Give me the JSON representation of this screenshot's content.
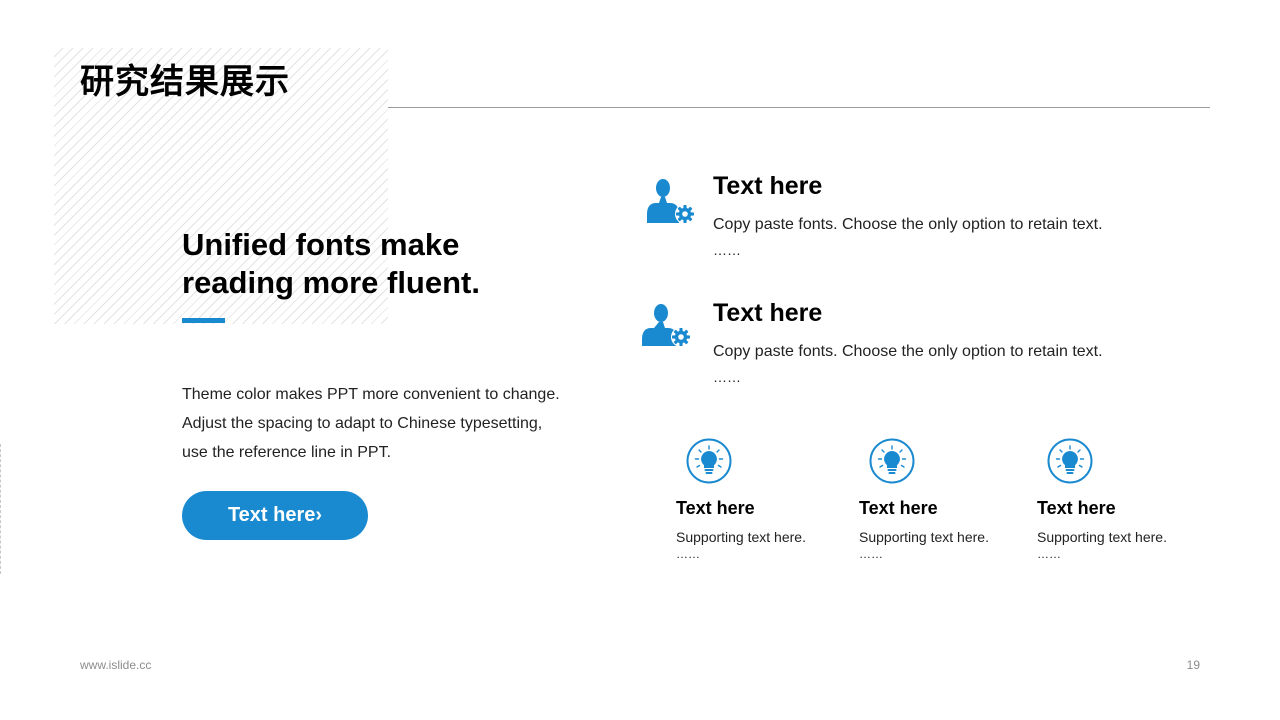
{
  "title": "研究结果展示",
  "headline": [
    "Unified fonts make",
    "reading more fluent."
  ],
  "body": [
    "Theme color makes PPT more convenient to change.",
    "Adjust the spacing to adapt to Chinese typesetting,",
    "use the reference line in PPT."
  ],
  "cta_label": "Text here›",
  "features": [
    {
      "heading": "Text here",
      "desc": "Copy paste fonts. Choose the only option to retain text.",
      "ellipsis": "……",
      "icon": "user-gear-icon"
    },
    {
      "heading": "Text here",
      "desc": "Copy paste fonts. Choose the only option to retain text.",
      "ellipsis": "……",
      "icon": "user-gear-icon"
    }
  ],
  "columns": [
    {
      "heading": "Text here",
      "sub": "Supporting text here.",
      "ellipsis": "……",
      "icon": "lightbulb-icon"
    },
    {
      "heading": "Text here",
      "sub": "Supporting text here.",
      "ellipsis": "……",
      "icon": "lightbulb-icon"
    },
    {
      "heading": "Text here",
      "sub": "Supporting  text here.",
      "ellipsis": "……",
      "icon": "lightbulb-icon"
    }
  ],
  "footer": {
    "website": "www.islide.cc",
    "page_number": "19"
  },
  "colors": {
    "accent": "#1a8ad0",
    "rule": "#9a9a9a",
    "hatch": "#e3e3e3"
  }
}
